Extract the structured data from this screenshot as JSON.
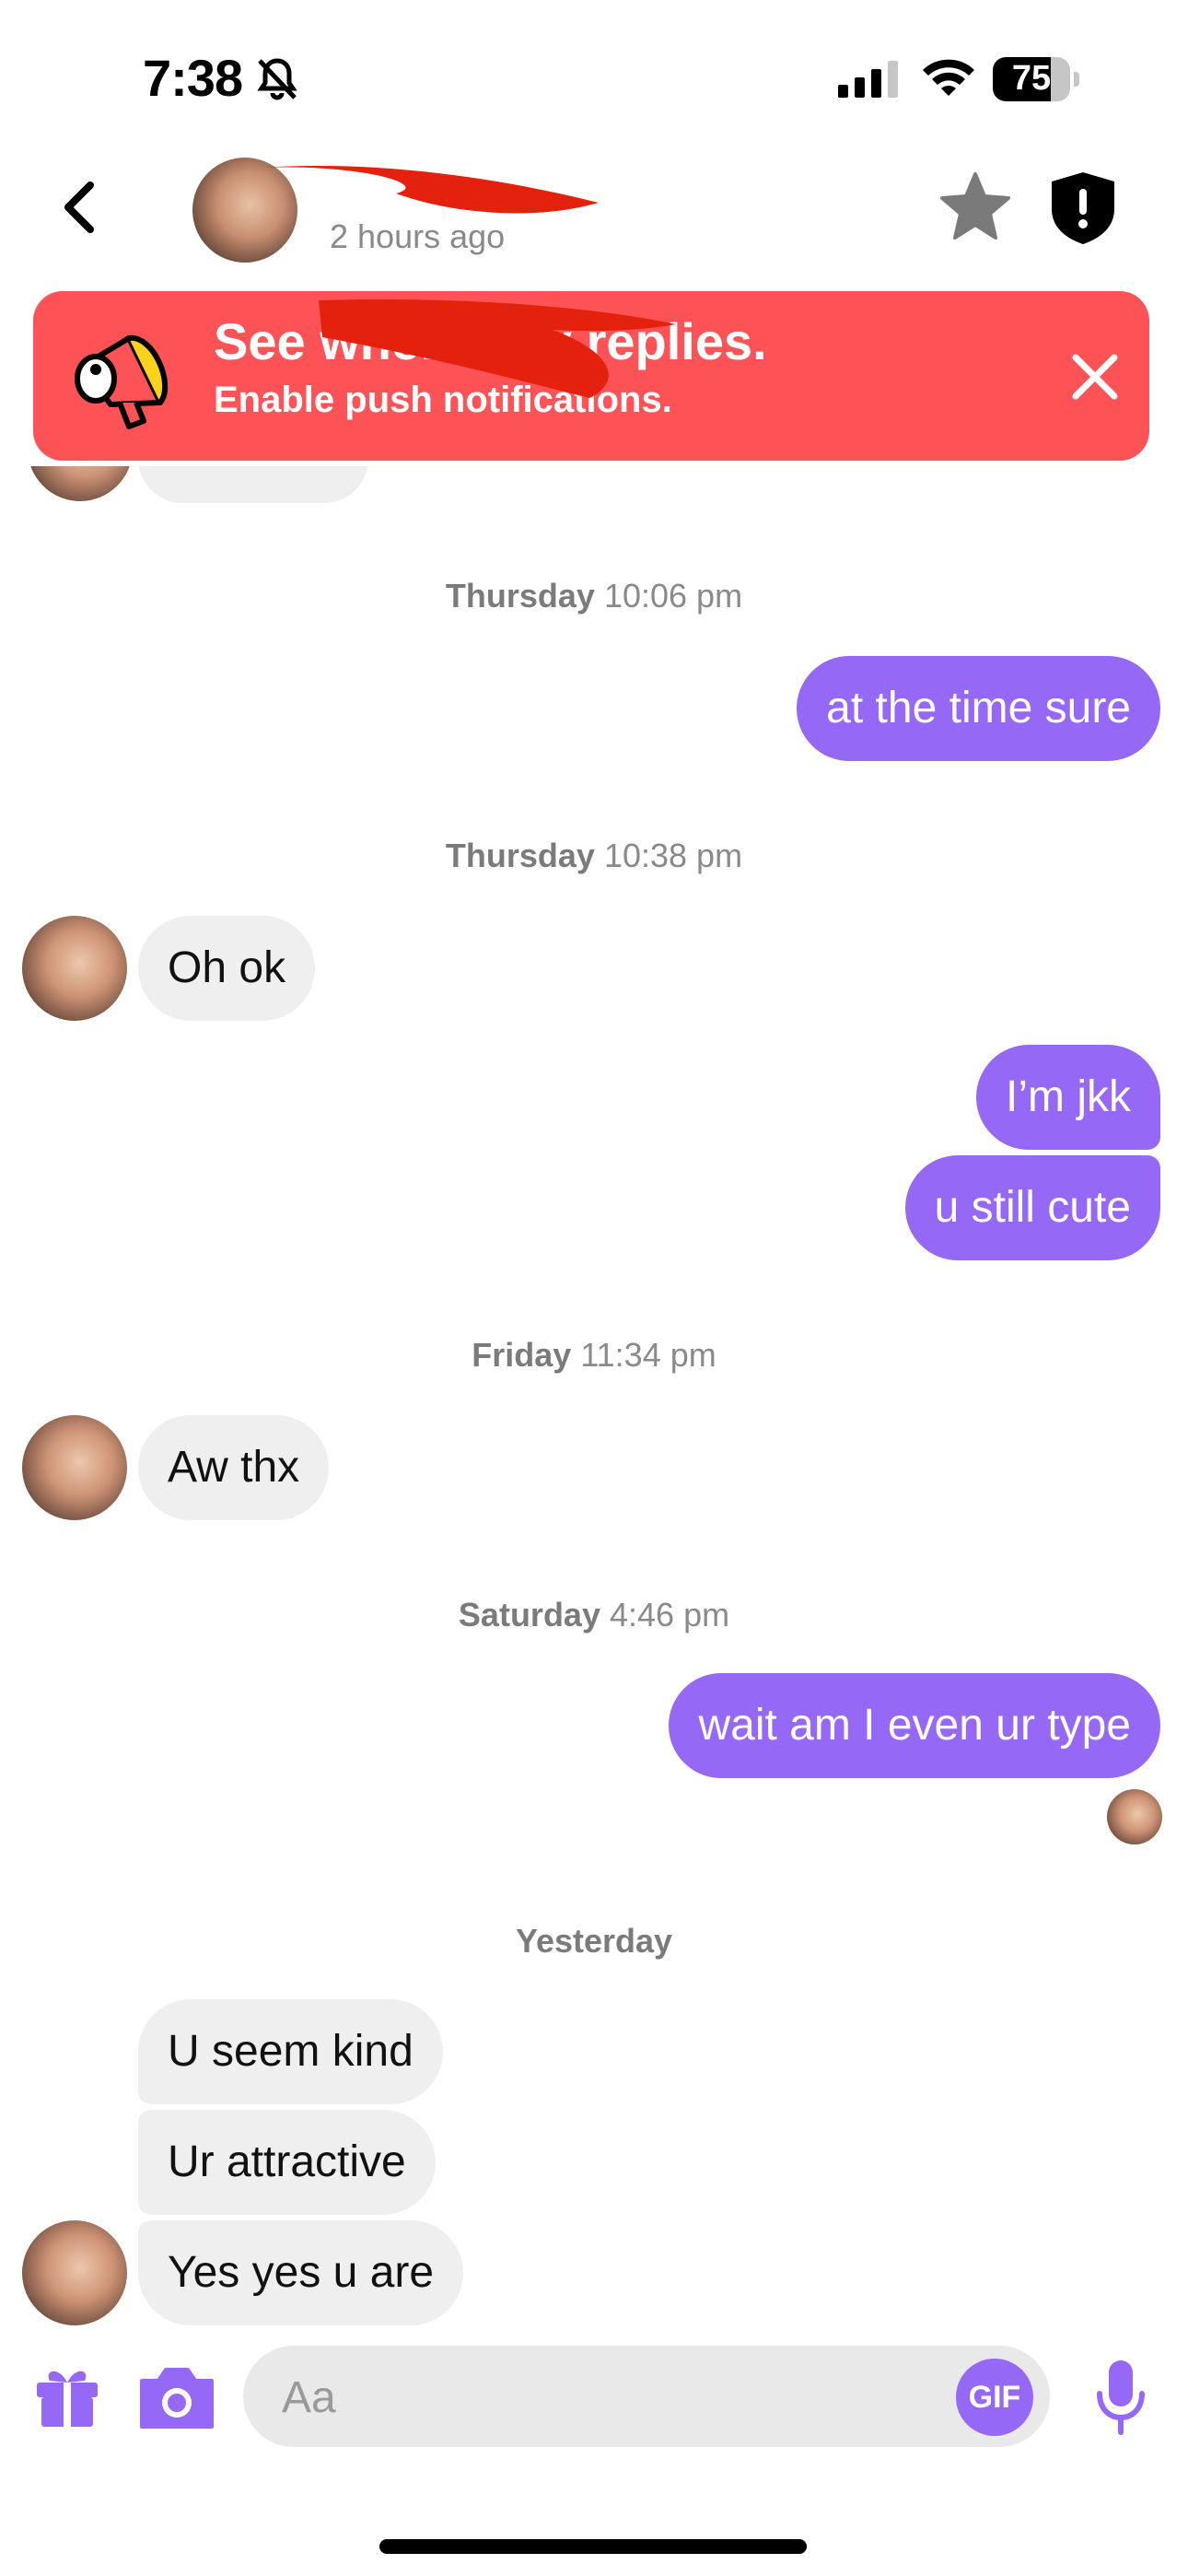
{
  "status_bar": {
    "time": "7:38",
    "battery": "75",
    "battery_level": 0.75
  },
  "header": {
    "last_seen": "2 hours ago"
  },
  "banner": {
    "title": "See when they replies.",
    "subtitle": "Enable push notifications."
  },
  "messages": {
    "ts1": {
      "day": "Thursday",
      "time": "10:06 pm"
    },
    "m1": "at the time sure",
    "ts2": {
      "day": "Thursday",
      "time": "10:38 pm"
    },
    "m2": "Oh ok",
    "m3": "I’m jkk",
    "m4": "u still cute",
    "ts3": {
      "day": "Friday",
      "time": "11:34 pm"
    },
    "m5": "Aw thx",
    "ts4": {
      "day": "Saturday",
      "time": "4:46 pm"
    },
    "m6": "wait am I even ur type",
    "ts5": {
      "day": "Yesterday"
    },
    "m7": "U seem kind",
    "m8": "Ur attractive",
    "m9": "Yes yes u are"
  },
  "composer": {
    "placeholder": "Aa",
    "gif_label": "GIF"
  },
  "colors": {
    "accent": "#9668f6",
    "banner": "#fd5356",
    "incoming": "#efefef"
  }
}
